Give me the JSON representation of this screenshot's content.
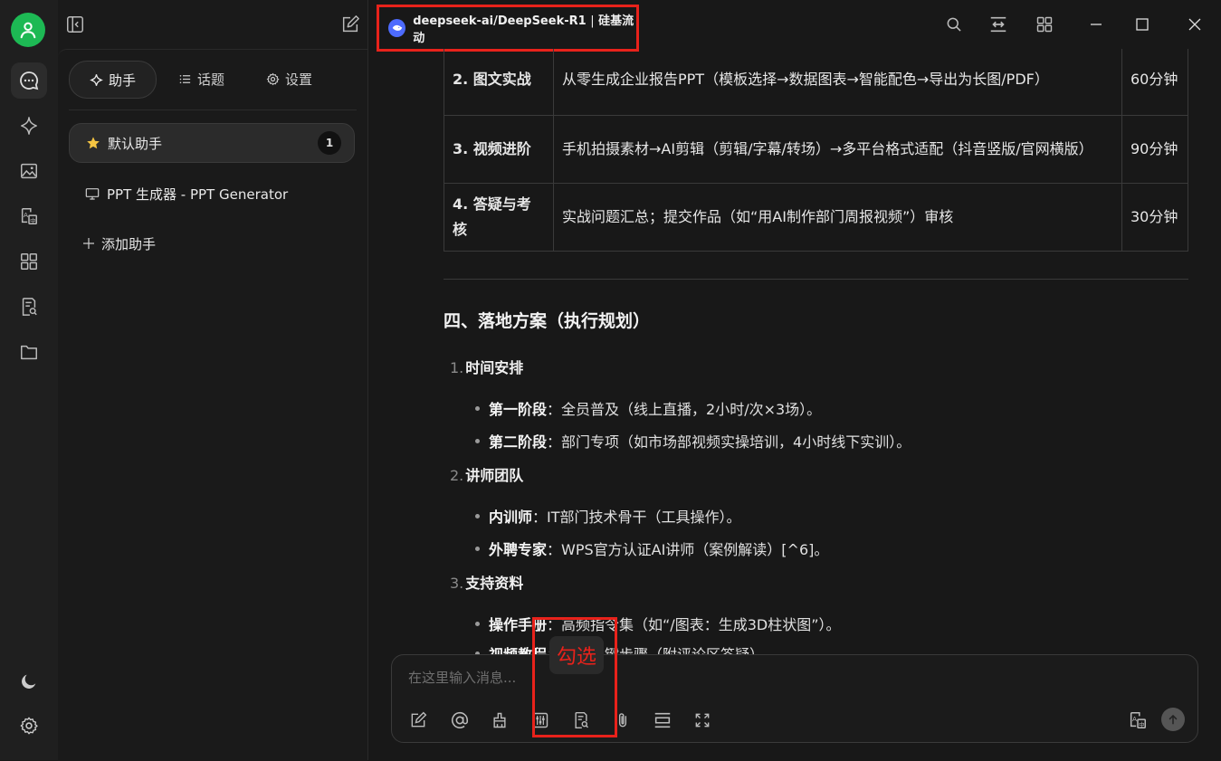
{
  "rail": {
    "avatar_icon": "user-icon",
    "items": [
      {
        "name": "chat-icon",
        "active": true
      },
      {
        "name": "sparkle-icon"
      },
      {
        "name": "image-icon"
      },
      {
        "name": "translate-icon"
      },
      {
        "name": "apps-grid-icon"
      },
      {
        "name": "doc-search-icon"
      },
      {
        "name": "folder-icon"
      }
    ],
    "bottom": [
      "moon-icon",
      "gear-icon"
    ]
  },
  "sidebar": {
    "tabs": [
      {
        "label": "助手",
        "icon": "sparkle-icon",
        "active": true
      },
      {
        "label": "话题",
        "icon": "list-icon"
      },
      {
        "label": "设置",
        "icon": "gear-icon"
      }
    ],
    "assistants": [
      {
        "label": "默认助手",
        "icon": "star-icon",
        "count": "1",
        "active": true
      },
      {
        "label": "PPT 生成器 - PPT Generator",
        "icon": "monitor-icon"
      }
    ],
    "add_label": "添加助手"
  },
  "titlebar": {
    "model": "deepseek-ai/DeepSeek-R1",
    "provider": "硅基流动",
    "separator": "|"
  },
  "content": {
    "table_rows": [
      {
        "stage": "2. 图文实战",
        "desc": "从零生成企业报告PPT（模板选择→数据图表→智能配色→导出为长图/PDF）",
        "time": "60分钟"
      },
      {
        "stage": "3. 视频进阶",
        "desc": "手机拍摄素材→AI剪辑（剪辑/字幕/转场）→多平台格式适配（抖音竖版/官网横版）",
        "time": "90分钟"
      },
      {
        "stage": "4. 答疑与考核",
        "desc": "实战问题汇总；提交作品（如“用AI制作部门周报视频”）审核",
        "time": "30分钟"
      }
    ],
    "section_title": "四、落地方案（执行规划）",
    "ol": [
      {
        "num": "1.",
        "title": "时间安排"
      },
      {
        "num": "2.",
        "title": "讲师团队"
      },
      {
        "num": "3.",
        "title": "支持资料"
      }
    ],
    "ul_1": [
      {
        "bold": "第一阶段",
        "text": "：全员普及（线上直播，2小时/次×3场）。"
      },
      {
        "bold": "第二阶段",
        "text": "：部门专项（如市场部视频实操培训，4小时线下实训）。"
      }
    ],
    "ul_2": [
      {
        "bold": "内训师",
        "text": "：IT部门技术骨干（工具操作）。"
      },
      {
        "bold": "外聘专家",
        "text": "：WPS官方认证AI讲师（案例解读）[^6]。"
      }
    ],
    "ul_3": [
      {
        "bold": "操作手册",
        "text": "：高频指令集（如“/图表：生成3D柱状图”）。"
      },
      {
        "bold": "视频教程",
        "text": "：分解关键步骤（附评论区答疑）。"
      }
    ]
  },
  "input": {
    "placeholder": "在这里输入消息...",
    "tools": [
      "edit-icon",
      "at-icon",
      "clean-icon",
      "sliders-icon",
      "web-search-icon",
      "attach-icon",
      "divider-icon",
      "expand-icon"
    ],
    "right_tools": [
      "translate-icon",
      "send-icon"
    ]
  },
  "annotation": {
    "tooltip_text": "勾选",
    "color": "#e8221b"
  }
}
